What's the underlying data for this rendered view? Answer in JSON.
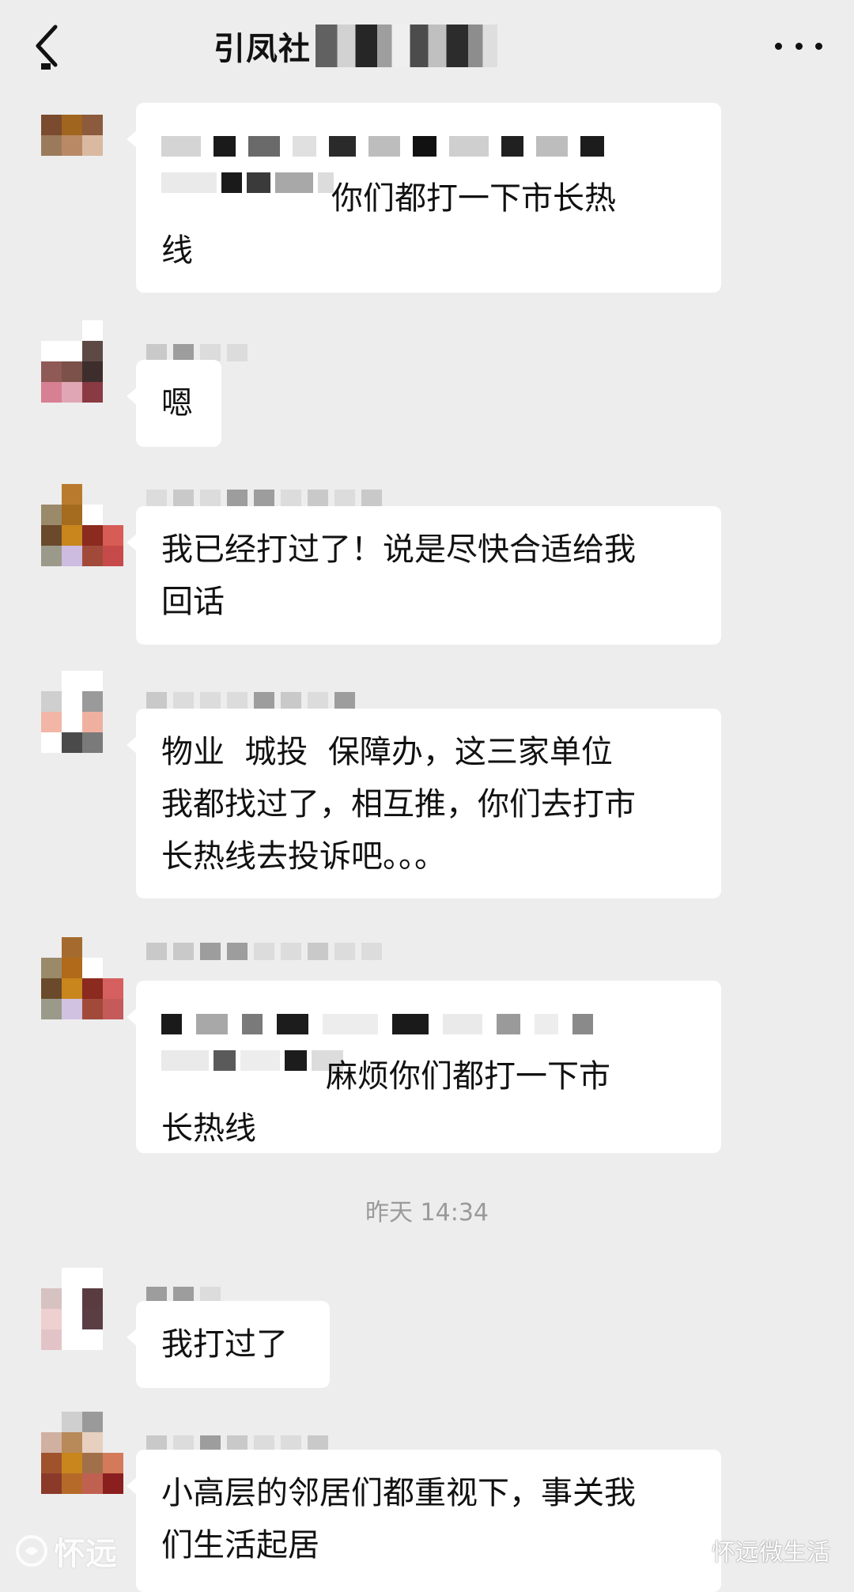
{
  "header": {
    "title": "引凤社",
    "back_icon": "chevron-left-icon",
    "more_icon": "more-dots-icon"
  },
  "messages": [
    {
      "text": "你们都打一下市长热\n线"
    },
    {
      "text": "嗯"
    },
    {
      "text": "我已经打过了！说是尽快合适给我\n回话"
    },
    {
      "text": "物业  城投  保障办，这三家单位\n我都找过了，相互推，你们去打市\n长热线去投诉吧。。。"
    },
    {
      "text": "麻烦你们都打一下市\n长热线"
    },
    {
      "text": "我打过了"
    },
    {
      "text": "小高层的邻居们都重视下，事关我\n们生活起居"
    }
  ],
  "timestamp": "昨天 14:34",
  "watermarks": {
    "left": "怀远",
    "right": "怀远微生活"
  },
  "colors": {
    "background": "#ededed",
    "bubble": "#ffffff",
    "timestamp": "#9a9a9a"
  }
}
